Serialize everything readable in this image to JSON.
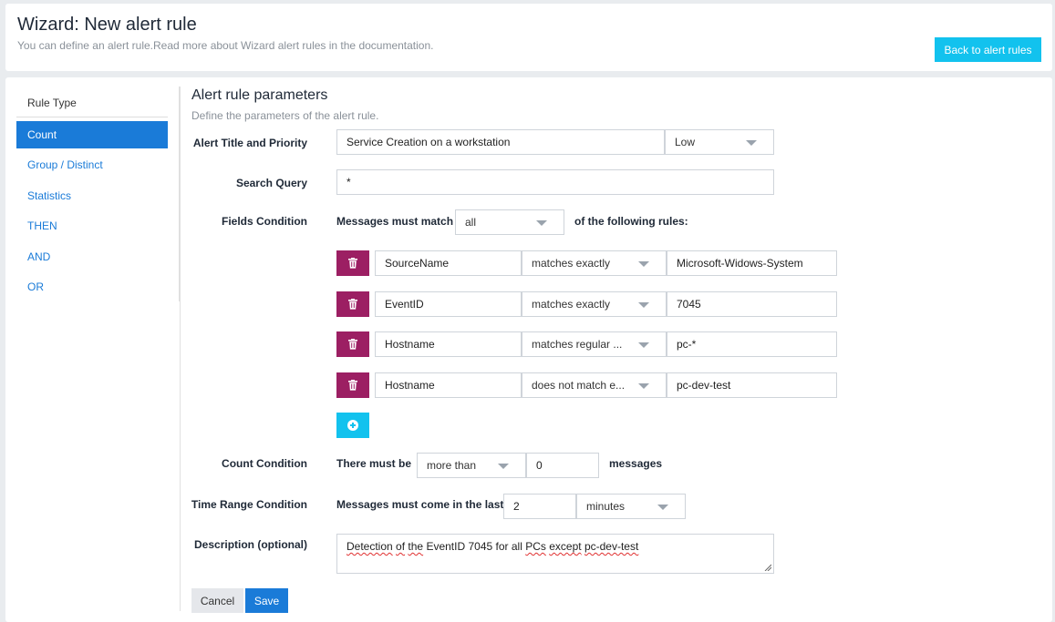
{
  "header": {
    "title": "Wizard: New alert rule",
    "subtitle": "You can define an alert rule.Read more about Wizard alert rules in the documentation.",
    "back_button": "Back to alert rules"
  },
  "sidebar": {
    "title": "Rule Type",
    "items": [
      {
        "label": "Count",
        "active": true
      },
      {
        "label": "Group / Distinct",
        "active": false
      },
      {
        "label": "Statistics",
        "active": false
      },
      {
        "label": "THEN",
        "active": false
      },
      {
        "label": "AND",
        "active": false
      },
      {
        "label": "OR",
        "active": false
      }
    ]
  },
  "form": {
    "section_title": "Alert rule parameters",
    "section_subtitle": "Define the parameters of the alert rule.",
    "title_priority": {
      "label": "Alert Title and Priority",
      "title_value": "Service Creation on a workstation",
      "priority_value": "Low"
    },
    "search_query": {
      "label": "Search Query",
      "value": "*"
    },
    "fields_condition": {
      "label": "Fields Condition",
      "prefix": "Messages must match",
      "match_value": "all",
      "suffix": "of the following rules:",
      "rules": [
        {
          "field": "SourceName",
          "operator": "matches exactly",
          "value": "Microsoft-Widows-System"
        },
        {
          "field": "EventID",
          "operator": "matches exactly",
          "value": "7045"
        },
        {
          "field": "Hostname",
          "operator": "matches regular ...",
          "value": "pc-*"
        },
        {
          "field": "Hostname",
          "operator": "does not match e...",
          "value": "pc-dev-test"
        }
      ]
    },
    "count_condition": {
      "label": "Count Condition",
      "prefix": "There must be",
      "comparator": "more than",
      "threshold": "0",
      "suffix": "messages"
    },
    "time_range_condition": {
      "label": "Time Range Condition",
      "prefix": "Messages must come in the last",
      "amount": "2",
      "unit": "minutes"
    },
    "description": {
      "label": "Description (optional)",
      "words": [
        "Detection",
        "of",
        "the",
        "EventID",
        "7045",
        "for",
        "all",
        "PCs",
        "except",
        "pc-dev-test"
      ]
    }
  },
  "actions": {
    "cancel": "Cancel",
    "save": "Save"
  },
  "colors": {
    "primary": "#1a7bd8",
    "accent": "#12c2ee",
    "danger": "#9c1f63"
  }
}
